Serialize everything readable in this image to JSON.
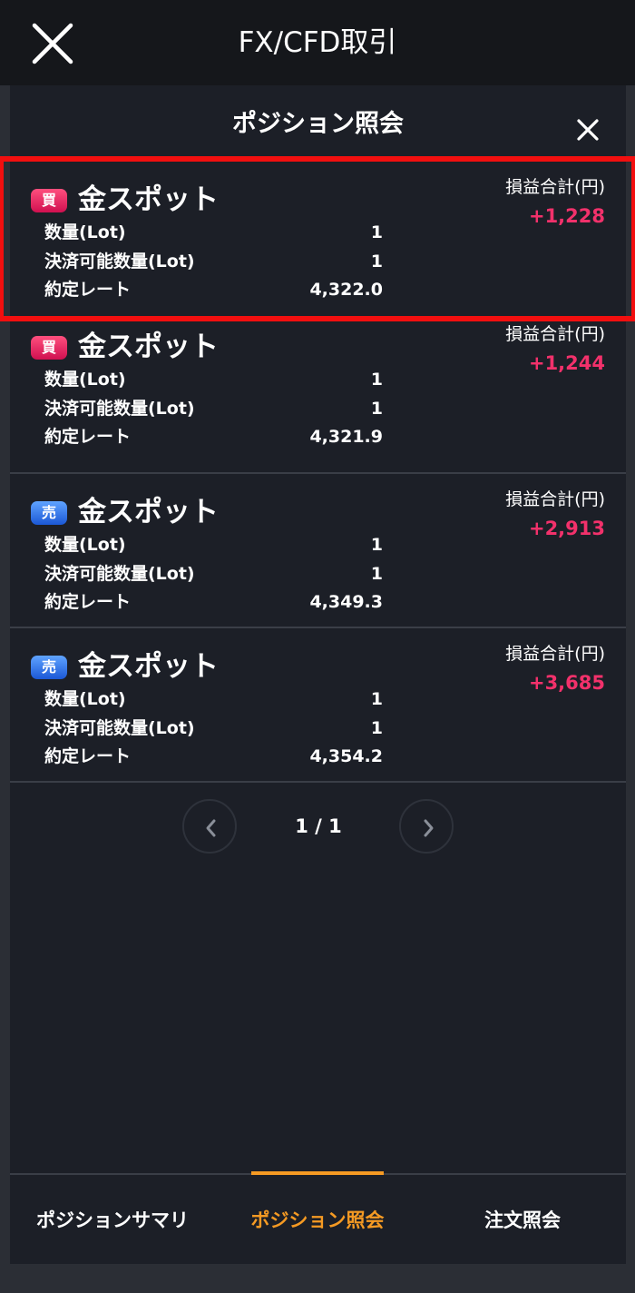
{
  "app": {
    "title": "FX/CFD取引",
    "close_icon": "close-icon"
  },
  "sheet": {
    "title": "ポジション照会",
    "close_icon": "close-icon"
  },
  "labels": {
    "quantity": "数量(Lot)",
    "settle_quantity": "決済可能数量(Lot)",
    "rate": "約定レート",
    "pl": "損益合計(円)"
  },
  "positions": [
    {
      "side": "買",
      "side_type": "buy",
      "name": "金スポット",
      "quantity": "1",
      "settle_quantity": "1",
      "rate": "4,322.0",
      "pl": "+1,228"
    },
    {
      "side": "買",
      "side_type": "buy",
      "name": "金スポット",
      "quantity": "1",
      "settle_quantity": "1",
      "rate": "4,321.9",
      "pl": "+1,244"
    },
    {
      "side": "売",
      "side_type": "sell",
      "name": "金スポット",
      "quantity": "1",
      "settle_quantity": "1",
      "rate": "4,349.3",
      "pl": "+2,913"
    },
    {
      "side": "売",
      "side_type": "sell",
      "name": "金スポット",
      "quantity": "1",
      "settle_quantity": "1",
      "rate": "4,354.2",
      "pl": "+3,685"
    }
  ],
  "pager": {
    "label": "1 / 1"
  },
  "tabs": [
    {
      "label": "ポジションサマリ",
      "active": false
    },
    {
      "label": "ポジション照会",
      "active": true
    },
    {
      "label": "注文照会",
      "active": false
    }
  ],
  "colors": {
    "accent": "#f59a23",
    "profit": "#f2316b",
    "buy": "#e0195a",
    "sell": "#2d6fe6",
    "highlight": "#f20f0f"
  }
}
